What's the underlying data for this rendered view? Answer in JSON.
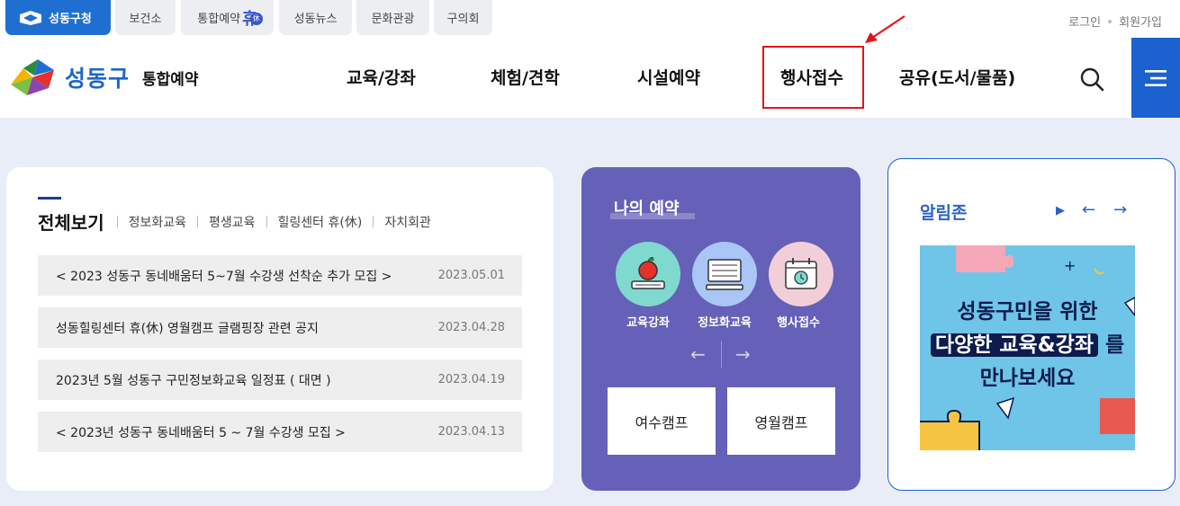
{
  "topbar": {
    "tabs": [
      {
        "label": "성동구청",
        "active": true
      },
      {
        "label": "보건소",
        "active": false
      },
      {
        "label": "통합예약",
        "active": false,
        "suffix": "휴",
        "badge": "休"
      },
      {
        "label": "성동뉴스",
        "active": false
      },
      {
        "label": "문화관광",
        "active": false
      },
      {
        "label": "구의회",
        "active": false
      }
    ],
    "login": "로그인",
    "signup": "회원가입"
  },
  "header": {
    "logo_name": "성동구",
    "logo_sub": "통합예약",
    "nav": [
      "교육/강좌",
      "체험/견학",
      "시설예약",
      "행사접수",
      "공유(도서/물품)"
    ],
    "highlighted_nav": "행사접수",
    "icons": {
      "search": "search-icon",
      "menu": "hamburger-menu-icon"
    }
  },
  "notice": {
    "title": "전체보기",
    "tabs": [
      "정보화교육",
      "평생교육",
      "힐링센터 휴(休)",
      "자치회관"
    ],
    "rows": [
      {
        "title": "< 2023 성동구 동네배움터 5~7월 수강생 선착순 추가 모집 >",
        "date": "2023.05.01"
      },
      {
        "title": "성동힐링센터 휴(休) 영월캠프 글램핑장 관련 공지",
        "date": "2023.04.28"
      },
      {
        "title": "2023년 5월 성동구 구민정보화교육 일정표 ( 대면 )",
        "date": "2023.04.19"
      },
      {
        "title": "< 2023년 성동구 동네배움터 5 ~ 7월 수강생 모집 >",
        "date": "2023.04.13"
      }
    ]
  },
  "reserve": {
    "title": "나의 예약",
    "items": [
      {
        "label": "교육강좌",
        "icon": "apple-book-icon",
        "color": "#7fd9cf"
      },
      {
        "label": "정보화교육",
        "icon": "computer-icon",
        "color": "#a9c6f7"
      },
      {
        "label": "행사접수",
        "icon": "calendar-icon",
        "color": "#f2cfd8"
      }
    ],
    "prev": "←",
    "next": "→",
    "camps": [
      "여수캠프",
      "영월캠프"
    ]
  },
  "alarm": {
    "title": "알림존",
    "controls": {
      "play": "▶",
      "prev": "←",
      "next": "→"
    },
    "banner": {
      "line1": "성동구민을 위한",
      "line2_highlight": "다양한 교육&강좌",
      "line2_rest": "를",
      "line3": "만나보세요"
    }
  },
  "colors": {
    "brand_blue": "#1f6fd1",
    "reserve_purple": "#6560b8",
    "annotation_red": "#e3141b",
    "page_bg": "#e9edf7"
  }
}
